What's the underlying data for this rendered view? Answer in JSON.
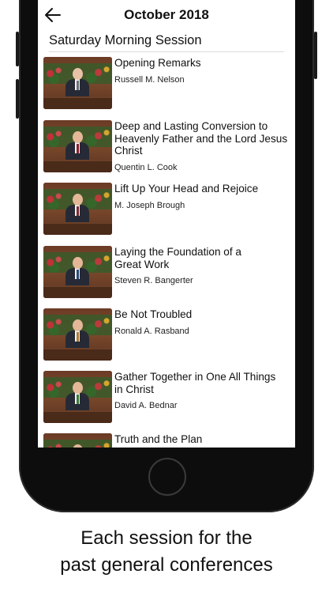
{
  "header": {
    "title": "October 2018"
  },
  "session_title": "Saturday Morning Session",
  "talks": [
    {
      "title": "Opening Remarks",
      "speaker": "Russell M. Nelson",
      "tie_color": "#6a6f7a"
    },
    {
      "title": "Deep and Lasting Conversion to Heavenly Father and the Lord Jesus Christ",
      "speaker": "Quentin L. Cook",
      "tie_color": "#8a1f2a"
    },
    {
      "title": "Lift Up Your Head and Rejoice",
      "speaker": "M. Joseph Brough",
      "tie_color": "#7a2a32"
    },
    {
      "title": "Laying the Foundation of a Great Work",
      "speaker": "Steven R. Bangerter",
      "tie_color": "#2b4a7a"
    },
    {
      "title": "Be Not Troubled",
      "speaker": "Ronald A. Rasband",
      "tie_color": "#b07a3a"
    },
    {
      "title": "Gather Together in One All Things in Christ",
      "speaker": "David A. Bednar",
      "tie_color": "#3d7a3a"
    },
    {
      "title": "Truth and the Plan",
      "speaker": "",
      "tie_color": "#6a6f7a"
    }
  ],
  "caption": {
    "line1": "Each session for the",
    "line2": "past general conferences"
  }
}
